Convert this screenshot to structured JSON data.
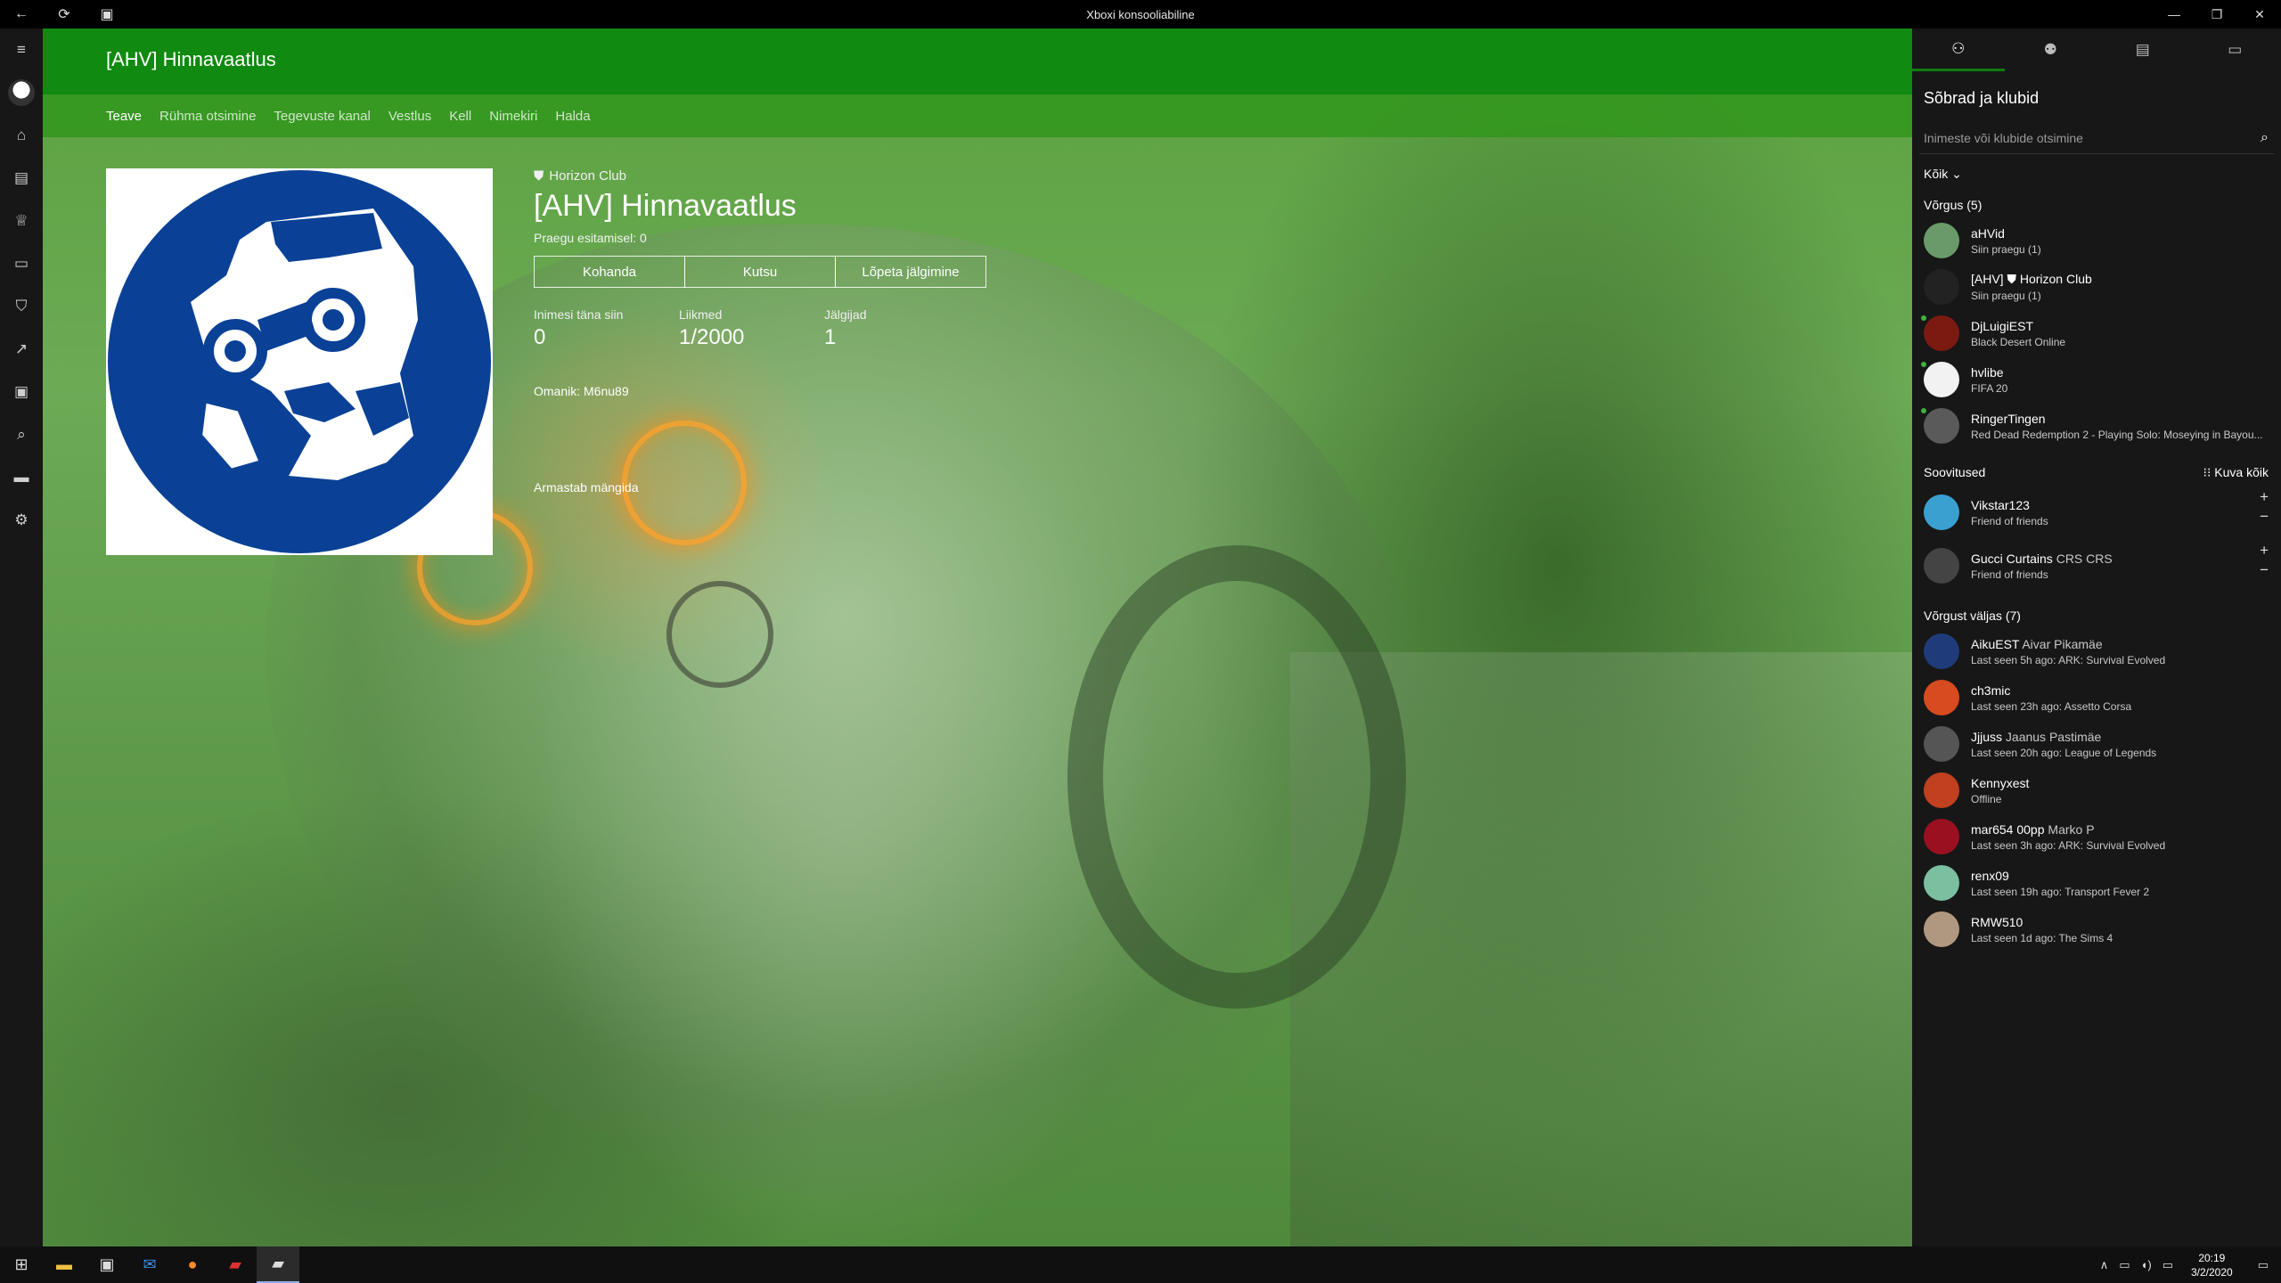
{
  "titlebar": {
    "title": "Xboxi konsooliabiline",
    "back_icon": "←",
    "refresh_icon": "⟳",
    "snap_icon": "▣",
    "minimize_icon": "—",
    "restore_icon": "❐",
    "close_icon": "✕"
  },
  "rail": {
    "menu_icon": "≡",
    "home_icon": "⌂",
    "library_icon": "▤",
    "achievements_icon": "♕",
    "messages_icon": "▭",
    "shield_icon": "⛉",
    "trending_icon": "↗",
    "store_icon": "▣",
    "search_icon": "⌕",
    "device_icon": "▬",
    "settings_icon": "⚙"
  },
  "club": {
    "header_title": "[AHV] Hinnavaatlus",
    "tabs": [
      "Teave",
      "Rühma otsimine",
      "Tegevuste kanal",
      "Vestlus",
      "Kell",
      "Nimekiri",
      "Halda"
    ],
    "club_type": "Horizon Club",
    "club_type_icon": "⛊",
    "name": "[AHV] Hinnavaatlus",
    "playing_now": "Praegu esitamisel: 0",
    "buttons": [
      "Kohanda",
      "Kutsu",
      "Lõpeta jälgimine"
    ],
    "stats": [
      {
        "label": "Inimesi täna siin",
        "value": "0"
      },
      {
        "label": "Liikmed",
        "value": "1/2000"
      },
      {
        "label": "Jälgijad",
        "value": "1"
      }
    ],
    "owner": "Omanik: M6nu89",
    "description": "Armastab mängida",
    "logo_color": "#0a4196"
  },
  "panel": {
    "tab_icons": [
      "⚇",
      "⚉",
      "▤",
      "▭"
    ],
    "title": "Sõbrad ja klubid",
    "search_placeholder": "Inimeste või klubide otsimine",
    "search_icon": "⌕",
    "filter": "Kõik",
    "filter_icon": "⌄",
    "online_header": "Võrgus (5)",
    "online": [
      {
        "name": "aHVid",
        "real": "",
        "status": "Siin praegu (1)",
        "color": "#6a9a6a"
      },
      {
        "name": "[AHV] ⛊ Horizon Club",
        "real": "",
        "status": "Siin praegu (1)",
        "color": "#222"
      },
      {
        "name": "DjLuigiEST",
        "real": "",
        "status": "Black Desert Online",
        "color": "#7a1a10"
      },
      {
        "name": "hvlibe",
        "real": "",
        "status": "FIFA 20",
        "color": "#f2f2f2"
      },
      {
        "name": "RingerTingen",
        "real": "",
        "status": "Red Dead Redemption 2 - Playing Solo: Moseying in Bayou...",
        "color": "#5a5a5a"
      }
    ],
    "suggestions_header": "Soovitused",
    "show_all": "Kuva kõik",
    "show_all_icon": "⁝⁝",
    "add_icon": "+",
    "remove_icon": "−",
    "suggestions": [
      {
        "name": "Vikstar123",
        "real": "",
        "status": "Friend of friends",
        "color": "#3aa0d0"
      },
      {
        "name": "Gucci Curtains",
        "real": "CRS CRS",
        "status": "Friend of friends",
        "color": "#444"
      }
    ],
    "offline_header": "Võrgust väljas (7)",
    "offline": [
      {
        "name": "AikuEST",
        "real": "Aivar Pikamäe",
        "status": "Last seen 5h ago: ARK: Survival Evolved",
        "color": "#1f3b7a"
      },
      {
        "name": "ch3mic",
        "real": "",
        "status": "Last seen 23h ago: Assetto Corsa",
        "color": "#d84a20"
      },
      {
        "name": "Jjjuss",
        "real": "Jaanus Pastimäe",
        "status": "Last seen 20h ago: League of Legends",
        "color": "#555"
      },
      {
        "name": "Kennyxest",
        "real": "",
        "status": "Offline",
        "color": "#c04020"
      },
      {
        "name": "mar654 00pp",
        "real": "Marko P",
        "status": "Last seen 3h ago: ARK: Survival Evolved",
        "color": "#9a1020"
      },
      {
        "name": "renx09",
        "real": "",
        "status": "Last seen 19h ago: Transport Fever 2",
        "color": "#7ac0a0"
      },
      {
        "name": "RMW510",
        "real": "",
        "status": "Last seen 1d ago: The Sims 4",
        "color": "#b09880"
      }
    ]
  },
  "taskbar": {
    "start_icon": "⊞",
    "apps": [
      {
        "name": "file-explorer",
        "icon": "▬",
        "color": "#f0c040"
      },
      {
        "name": "store",
        "icon": "▣",
        "color": "#ddd"
      },
      {
        "name": "mail",
        "icon": "✉",
        "color": "#3a8ee6"
      },
      {
        "name": "firefox",
        "icon": "●",
        "color": "#ff8a2a"
      },
      {
        "name": "app-red",
        "icon": "▰",
        "color": "#e03030"
      },
      {
        "name": "xbox-companion",
        "icon": "▰",
        "color": "#ddd"
      }
    ],
    "tray_icons": [
      "∧",
      "▭",
      "◖)",
      "▭"
    ],
    "time": "20:19",
    "date": "3/2/2020",
    "notification_icon": "▭"
  }
}
